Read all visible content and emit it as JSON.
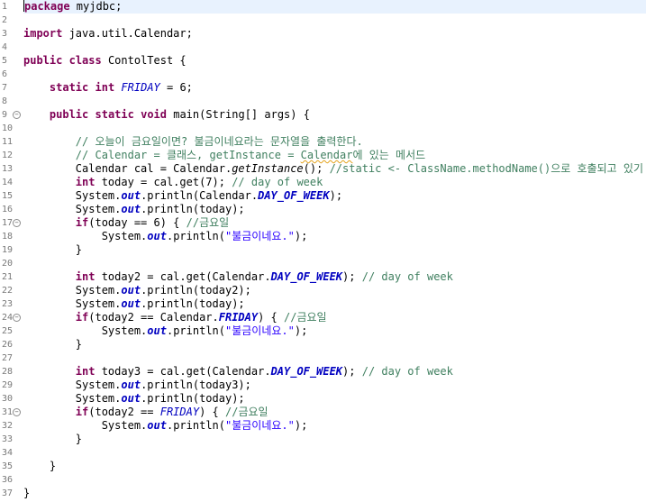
{
  "editor": {
    "lines": [
      {
        "n": "1",
        "t": [
          [
            "kw",
            "package"
          ],
          [
            "pl",
            " myjdbc;"
          ]
        ]
      },
      {
        "n": "2",
        "t": []
      },
      {
        "n": "3",
        "t": [
          [
            "kw",
            "import"
          ],
          [
            "pl",
            " java.util.Calendar;"
          ]
        ]
      },
      {
        "n": "4",
        "t": []
      },
      {
        "n": "5",
        "t": [
          [
            "kw",
            "public"
          ],
          [
            "pl",
            " "
          ],
          [
            "kw",
            "class"
          ],
          [
            "pl",
            " ContolTest {"
          ]
        ]
      },
      {
        "n": "6",
        "t": []
      },
      {
        "n": "7",
        "t": [
          [
            "pl",
            "    "
          ],
          [
            "kw",
            "static"
          ],
          [
            "pl",
            " "
          ],
          [
            "kw",
            "int"
          ],
          [
            "pl",
            " "
          ],
          [
            "sfi",
            "FRIDAY"
          ],
          [
            "pl",
            " = 6;"
          ]
        ]
      },
      {
        "n": "8",
        "t": []
      },
      {
        "n": "9",
        "fold": true,
        "t": [
          [
            "pl",
            "    "
          ],
          [
            "kw",
            "public"
          ],
          [
            "pl",
            " "
          ],
          [
            "kw",
            "static"
          ],
          [
            "pl",
            " "
          ],
          [
            "kw",
            "void"
          ],
          [
            "pl",
            " main(String[] args) {"
          ]
        ]
      },
      {
        "n": "10",
        "t": []
      },
      {
        "n": "11",
        "t": [
          [
            "pl",
            "        "
          ],
          [
            "cm",
            "// 오늘이 금요일이면? 불금이네요라는 문자열을 출력한다."
          ]
        ]
      },
      {
        "n": "12",
        "t": [
          [
            "pl",
            "        "
          ],
          [
            "cm",
            "// Calendar = 클래스, getInstance = "
          ],
          [
            "cmsq",
            "Calendar"
          ],
          [
            "cm",
            "에 있는 메서드"
          ]
        ]
      },
      {
        "n": "13",
        "t": [
          [
            "pl",
            "        Calendar cal = Calendar."
          ],
          [
            "sm",
            "getInstance"
          ],
          [
            "pl",
            "(); "
          ],
          [
            "cm",
            "//static <- ClassName.methodName()으로 호출되고 있기 때문"
          ]
        ]
      },
      {
        "n": "14",
        "t": [
          [
            "pl",
            "        "
          ],
          [
            "kw",
            "int"
          ],
          [
            "pl",
            " today = cal.get(7); "
          ],
          [
            "cm",
            "// day of week"
          ]
        ]
      },
      {
        "n": "15",
        "t": [
          [
            "pl",
            "        System."
          ],
          [
            "sf",
            "out"
          ],
          [
            "pl",
            ".println(Calendar."
          ],
          [
            "sf",
            "DAY_OF_WEEK"
          ],
          [
            "pl",
            ");"
          ]
        ]
      },
      {
        "n": "16",
        "t": [
          [
            "pl",
            "        System."
          ],
          [
            "sf",
            "out"
          ],
          [
            "pl",
            ".println(today);"
          ]
        ]
      },
      {
        "n": "17",
        "fold": true,
        "t": [
          [
            "pl",
            "        "
          ],
          [
            "kw",
            "if"
          ],
          [
            "pl",
            "(today == 6) { "
          ],
          [
            "cm",
            "//금요일"
          ]
        ]
      },
      {
        "n": "18",
        "t": [
          [
            "pl",
            "            System."
          ],
          [
            "sf",
            "out"
          ],
          [
            "pl",
            ".println("
          ],
          [
            "st",
            "\"불금이네요.\""
          ],
          [
            "pl",
            ");"
          ]
        ]
      },
      {
        "n": "19",
        "t": [
          [
            "pl",
            "        }"
          ]
        ]
      },
      {
        "n": "20",
        "t": []
      },
      {
        "n": "21",
        "t": [
          [
            "pl",
            "        "
          ],
          [
            "kw",
            "int"
          ],
          [
            "pl",
            " today2 = cal.get(Calendar."
          ],
          [
            "sf",
            "DAY_OF_WEEK"
          ],
          [
            "pl",
            "); "
          ],
          [
            "cm",
            "// day of week"
          ]
        ]
      },
      {
        "n": "22",
        "t": [
          [
            "pl",
            "        System."
          ],
          [
            "sf",
            "out"
          ],
          [
            "pl",
            ".println(today2);"
          ]
        ]
      },
      {
        "n": "23",
        "t": [
          [
            "pl",
            "        System."
          ],
          [
            "sf",
            "out"
          ],
          [
            "pl",
            ".println(today);"
          ]
        ]
      },
      {
        "n": "24",
        "fold": true,
        "t": [
          [
            "pl",
            "        "
          ],
          [
            "kw",
            "if"
          ],
          [
            "pl",
            "(today2 == Calendar."
          ],
          [
            "sf",
            "FRIDAY"
          ],
          [
            "pl",
            ") { "
          ],
          [
            "cm",
            "//금요일"
          ]
        ]
      },
      {
        "n": "25",
        "t": [
          [
            "pl",
            "            System."
          ],
          [
            "sf",
            "out"
          ],
          [
            "pl",
            ".println("
          ],
          [
            "st",
            "\"불금이네요.\""
          ],
          [
            "pl",
            ");"
          ]
        ]
      },
      {
        "n": "26",
        "t": [
          [
            "pl",
            "        }"
          ]
        ]
      },
      {
        "n": "27",
        "t": []
      },
      {
        "n": "28",
        "t": [
          [
            "pl",
            "        "
          ],
          [
            "kw",
            "int"
          ],
          [
            "pl",
            " today3 = cal.get(Calendar."
          ],
          [
            "sf",
            "DAY_OF_WEEK"
          ],
          [
            "pl",
            "); "
          ],
          [
            "cm",
            "// day of week"
          ]
        ]
      },
      {
        "n": "29",
        "t": [
          [
            "pl",
            "        System."
          ],
          [
            "sf",
            "out"
          ],
          [
            "pl",
            ".println(today3);"
          ]
        ]
      },
      {
        "n": "30",
        "t": [
          [
            "pl",
            "        System."
          ],
          [
            "sf",
            "out"
          ],
          [
            "pl",
            ".println(today);"
          ]
        ]
      },
      {
        "n": "31",
        "fold": true,
        "t": [
          [
            "pl",
            "        "
          ],
          [
            "kw",
            "if"
          ],
          [
            "pl",
            "(today2 == "
          ],
          [
            "sfi",
            "FRIDAY"
          ],
          [
            "pl",
            ") { "
          ],
          [
            "cm",
            "//금요일"
          ]
        ]
      },
      {
        "n": "32",
        "t": [
          [
            "pl",
            "            System."
          ],
          [
            "sf",
            "out"
          ],
          [
            "pl",
            ".println("
          ],
          [
            "st",
            "\"불금이네요.\""
          ],
          [
            "pl",
            ");"
          ]
        ]
      },
      {
        "n": "33",
        "t": [
          [
            "pl",
            "        }"
          ]
        ]
      },
      {
        "n": "34",
        "t": []
      },
      {
        "n": "35",
        "t": [
          [
            "pl",
            "    }"
          ]
        ]
      },
      {
        "n": "36",
        "t": []
      },
      {
        "n": "37",
        "t": [
          [
            "pl",
            "}"
          ]
        ]
      }
    ],
    "current_line": "1",
    "colors": {
      "keyword": "#7f0055",
      "comment": "#3f7f5f",
      "string": "#2a00ff",
      "static_field": "#0000c0",
      "current_line_bg": "#e8f2fe",
      "line_number": "#787878"
    }
  }
}
